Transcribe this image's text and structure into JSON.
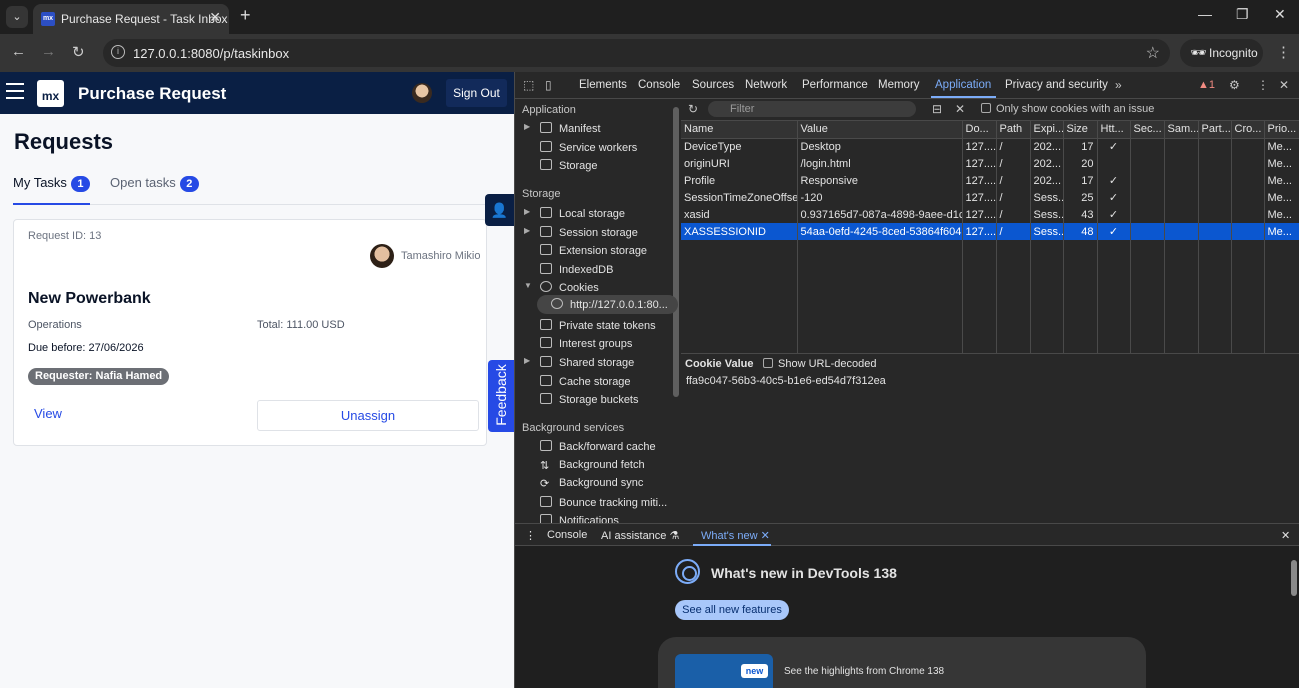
{
  "browser": {
    "tab_title": "Purchase Request - Task Inbox",
    "favicon_text": "mx",
    "url": "127.0.0.1:8080/p/taskinbox",
    "incognito_label": "Incognito"
  },
  "app": {
    "logo_text": "mx",
    "title": "Purchase Request",
    "signout_label": "Sign Out",
    "page_title": "Requests",
    "tabs": [
      {
        "label": "My Tasks",
        "count": "1"
      },
      {
        "label": "Open tasks",
        "count": "2"
      }
    ],
    "card": {
      "request_id": "Request ID: 13",
      "user": "Tamashiro Mikio",
      "title": "New Powerbank",
      "department": "Operations",
      "total": "Total: 111.00 USD",
      "due": "Due before: 27/06/2026",
      "requester": "Requester: Nafia Hamed",
      "view_label": "View",
      "unassign_label": "Unassign"
    },
    "feedback_label": "Feedback"
  },
  "devtools": {
    "tabs": [
      "Elements",
      "Console",
      "Sources",
      "Network",
      "Performance",
      "Memory",
      "Application",
      "Privacy and security"
    ],
    "active_tab": "Application",
    "warning_count": "1",
    "sidebar": {
      "application_header": "Application",
      "application_items": [
        "Manifest",
        "Service workers",
        "Storage"
      ],
      "storage_header": "Storage",
      "storage_items": [
        "Local storage",
        "Session storage",
        "Extension storage",
        "IndexedDB",
        "Cookies",
        "http://127.0.0.1:80...",
        "Private state tokens",
        "Interest groups",
        "Shared storage",
        "Cache storage",
        "Storage buckets"
      ],
      "background_header": "Background services",
      "background_items": [
        "Back/forward cache",
        "Background fetch",
        "Background sync",
        "Bounce tracking miti...",
        "Notifications"
      ]
    },
    "filter_placeholder": "Filter",
    "only_issue_label": "Only show cookies with an issue",
    "columns": [
      "Name",
      "Value",
      "Do...",
      "Path",
      "Expi...",
      "Size",
      "Htt...",
      "Sec...",
      "Sam...",
      "Part...",
      "Cro...",
      "Prio..."
    ],
    "cookies": [
      {
        "name": "DeviceType",
        "value": "Desktop",
        "domain": "127....",
        "path": "/",
        "expires": "202...",
        "size": "17",
        "http": "✓",
        "prio": "Me..."
      },
      {
        "name": "originURI",
        "value": "/login.html",
        "domain": "127....",
        "path": "/",
        "expires": "202...",
        "size": "20",
        "http": "",
        "prio": "Me..."
      },
      {
        "name": "Profile",
        "value": "Responsive",
        "domain": "127....",
        "path": "/",
        "expires": "202...",
        "size": "17",
        "http": "✓",
        "prio": "Me..."
      },
      {
        "name": "SessionTimeZoneOffset",
        "value": "-120",
        "domain": "127....",
        "path": "/",
        "expires": "Sess...",
        "size": "25",
        "http": "✓",
        "prio": "Me..."
      },
      {
        "name": "xasid",
        "value": "0.937165d7-087a-4898-9aee-d1c...",
        "domain": "127....",
        "path": "/",
        "expires": "Sess...",
        "size": "43",
        "http": "✓",
        "prio": "Me..."
      },
      {
        "name": "XASSESSIONID",
        "value": "54aa-0efd-4245-8ced-53864f604bb7",
        "domain": "127....",
        "path": "/",
        "expires": "Sess...",
        "size": "48",
        "http": "✓",
        "prio": "Me..."
      }
    ],
    "cookie_value_title": "Cookie Value",
    "show_decoded_label": "Show URL-decoded",
    "cookie_value": "ffa9c047-56b3-40c5-b1e6-ed54d7f312ea",
    "drawer_tabs": [
      "Console",
      "AI assistance",
      "What's new"
    ],
    "whats_new_title": "What's new in DevTools 138",
    "see_all_label": "See all new features",
    "new_badge": "new",
    "highlights_text": "See the highlights from Chrome 138"
  },
  "colors": {
    "app_header": "#0a1f44",
    "accent": "#264ae5",
    "devtools_bg": "#282828",
    "selection": "#0b57d0"
  }
}
